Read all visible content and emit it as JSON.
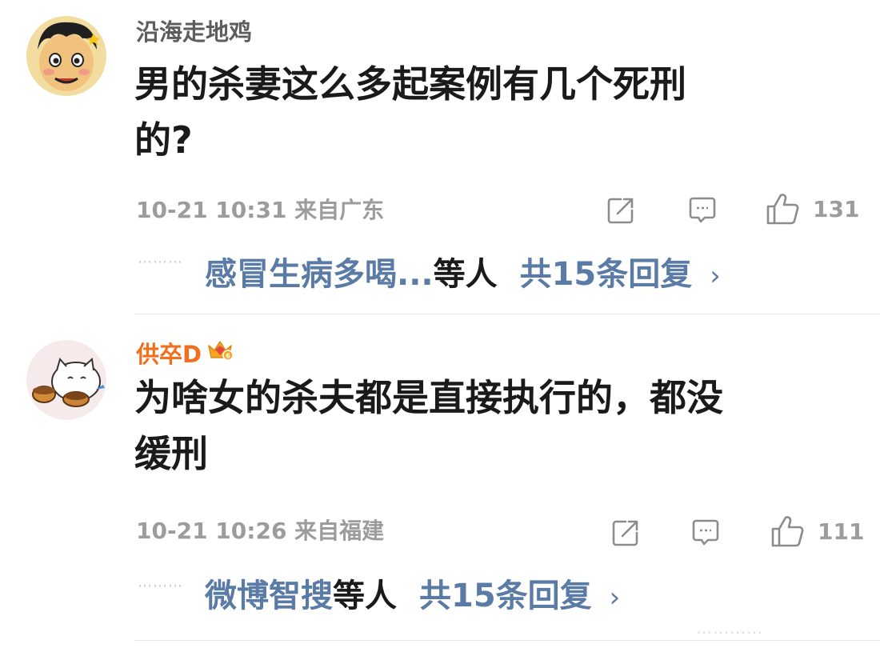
{
  "comments": [
    {
      "username": "沿海走地鸡",
      "text_line1": "男的杀妻这么多起案例有几个死刑",
      "text_line2": "的?",
      "meta": "10-21 10:31 来自广东",
      "likes": "131",
      "reply_dots": "⋯⋯⋯",
      "reply_names": "感冒生病多喝...",
      "reply_etc": "等人",
      "reply_total": "共15条回复",
      "reply_chevron": "›"
    },
    {
      "username": "供卒D",
      "text_line1": "为啥女的杀夫都是直接执行的，都没",
      "text_line2": "缓刑",
      "meta": "10-21 10:26 来自福建",
      "likes": "111",
      "reply_dots": "⋯⋯⋯",
      "reply_names": "微博智搜",
      "reply_etc": "等人",
      "reply_total": "共15条回复",
      "reply_chevron": "›"
    }
  ],
  "icons": {
    "share": "share-icon",
    "reply": "comment-icon",
    "like": "thumbs-up-icon",
    "vip": "vip-crown-badge-icon"
  },
  "pager_dots": "⋯⋯⋯⋯"
}
